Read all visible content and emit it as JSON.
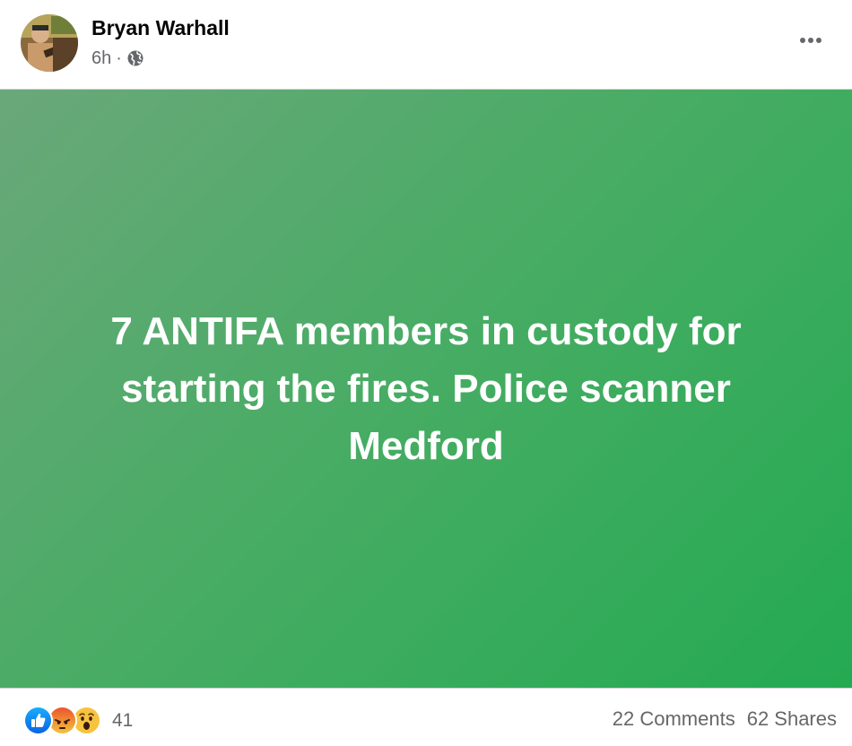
{
  "post": {
    "author": "Bryan Warhall",
    "time": "6h",
    "separator": "·",
    "privacy_icon": "globe-icon",
    "menu_icon": "more-horizontal-icon"
  },
  "status": {
    "text": "7 ANTIFA members in custody for starting the fires. Police scanner Medford",
    "background_start": "#6aa87a",
    "background_end": "#24aa52",
    "text_color": "#ffffff"
  },
  "footer": {
    "reactions": [
      "like-icon",
      "angry-icon",
      "wow-icon"
    ],
    "reaction_count": "41",
    "comments": "22 Comments",
    "shares": "62 Shares"
  }
}
